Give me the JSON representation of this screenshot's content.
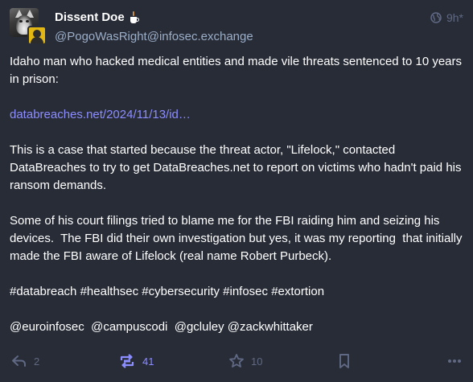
{
  "author": {
    "display_name": "Dissent Doe",
    "display_name_emoji": "coffee-icon",
    "handle": "@PogoWasRight@infosec.exchange",
    "avatar": "husky-avatar",
    "secondary_avatar": "person-avatar"
  },
  "meta": {
    "visibility_icon": "globe-icon",
    "time": "9h",
    "time_suffix": "*"
  },
  "content": {
    "paragraph1": "Idaho man who hacked medical entities and made vile threats sentenced to 10 years in prison:",
    "link": "databreaches.net/2024/11/13/id…",
    "paragraph3": "This is a case that started because the threat actor, \"Lifelock,\" contacted DataBreaches to try to get DataBreaches.net to report on victims who hadn't paid his ransom demands.",
    "paragraph4": "Some of his court filings tried to blame me for the FBI raiding him and seizing his devices.  The FBI did their own investigation but yes, it was my reporting  that initially made the FBI aware of Lifelock (real name Robert Purbeck).",
    "hashtags": "#databreach #healthsec #cybersecurity #infosec #extortion",
    "mentions": "@euroinfosec  @campuscodi  @gcluley @zackwhittaker"
  },
  "actions": {
    "reply_count": "2",
    "boost_count": "41",
    "favourite_count": "10"
  },
  "colors": {
    "background": "#282c37",
    "accent": "#8c8dff",
    "muted": "#606984",
    "secondary_text": "#9baec8"
  }
}
